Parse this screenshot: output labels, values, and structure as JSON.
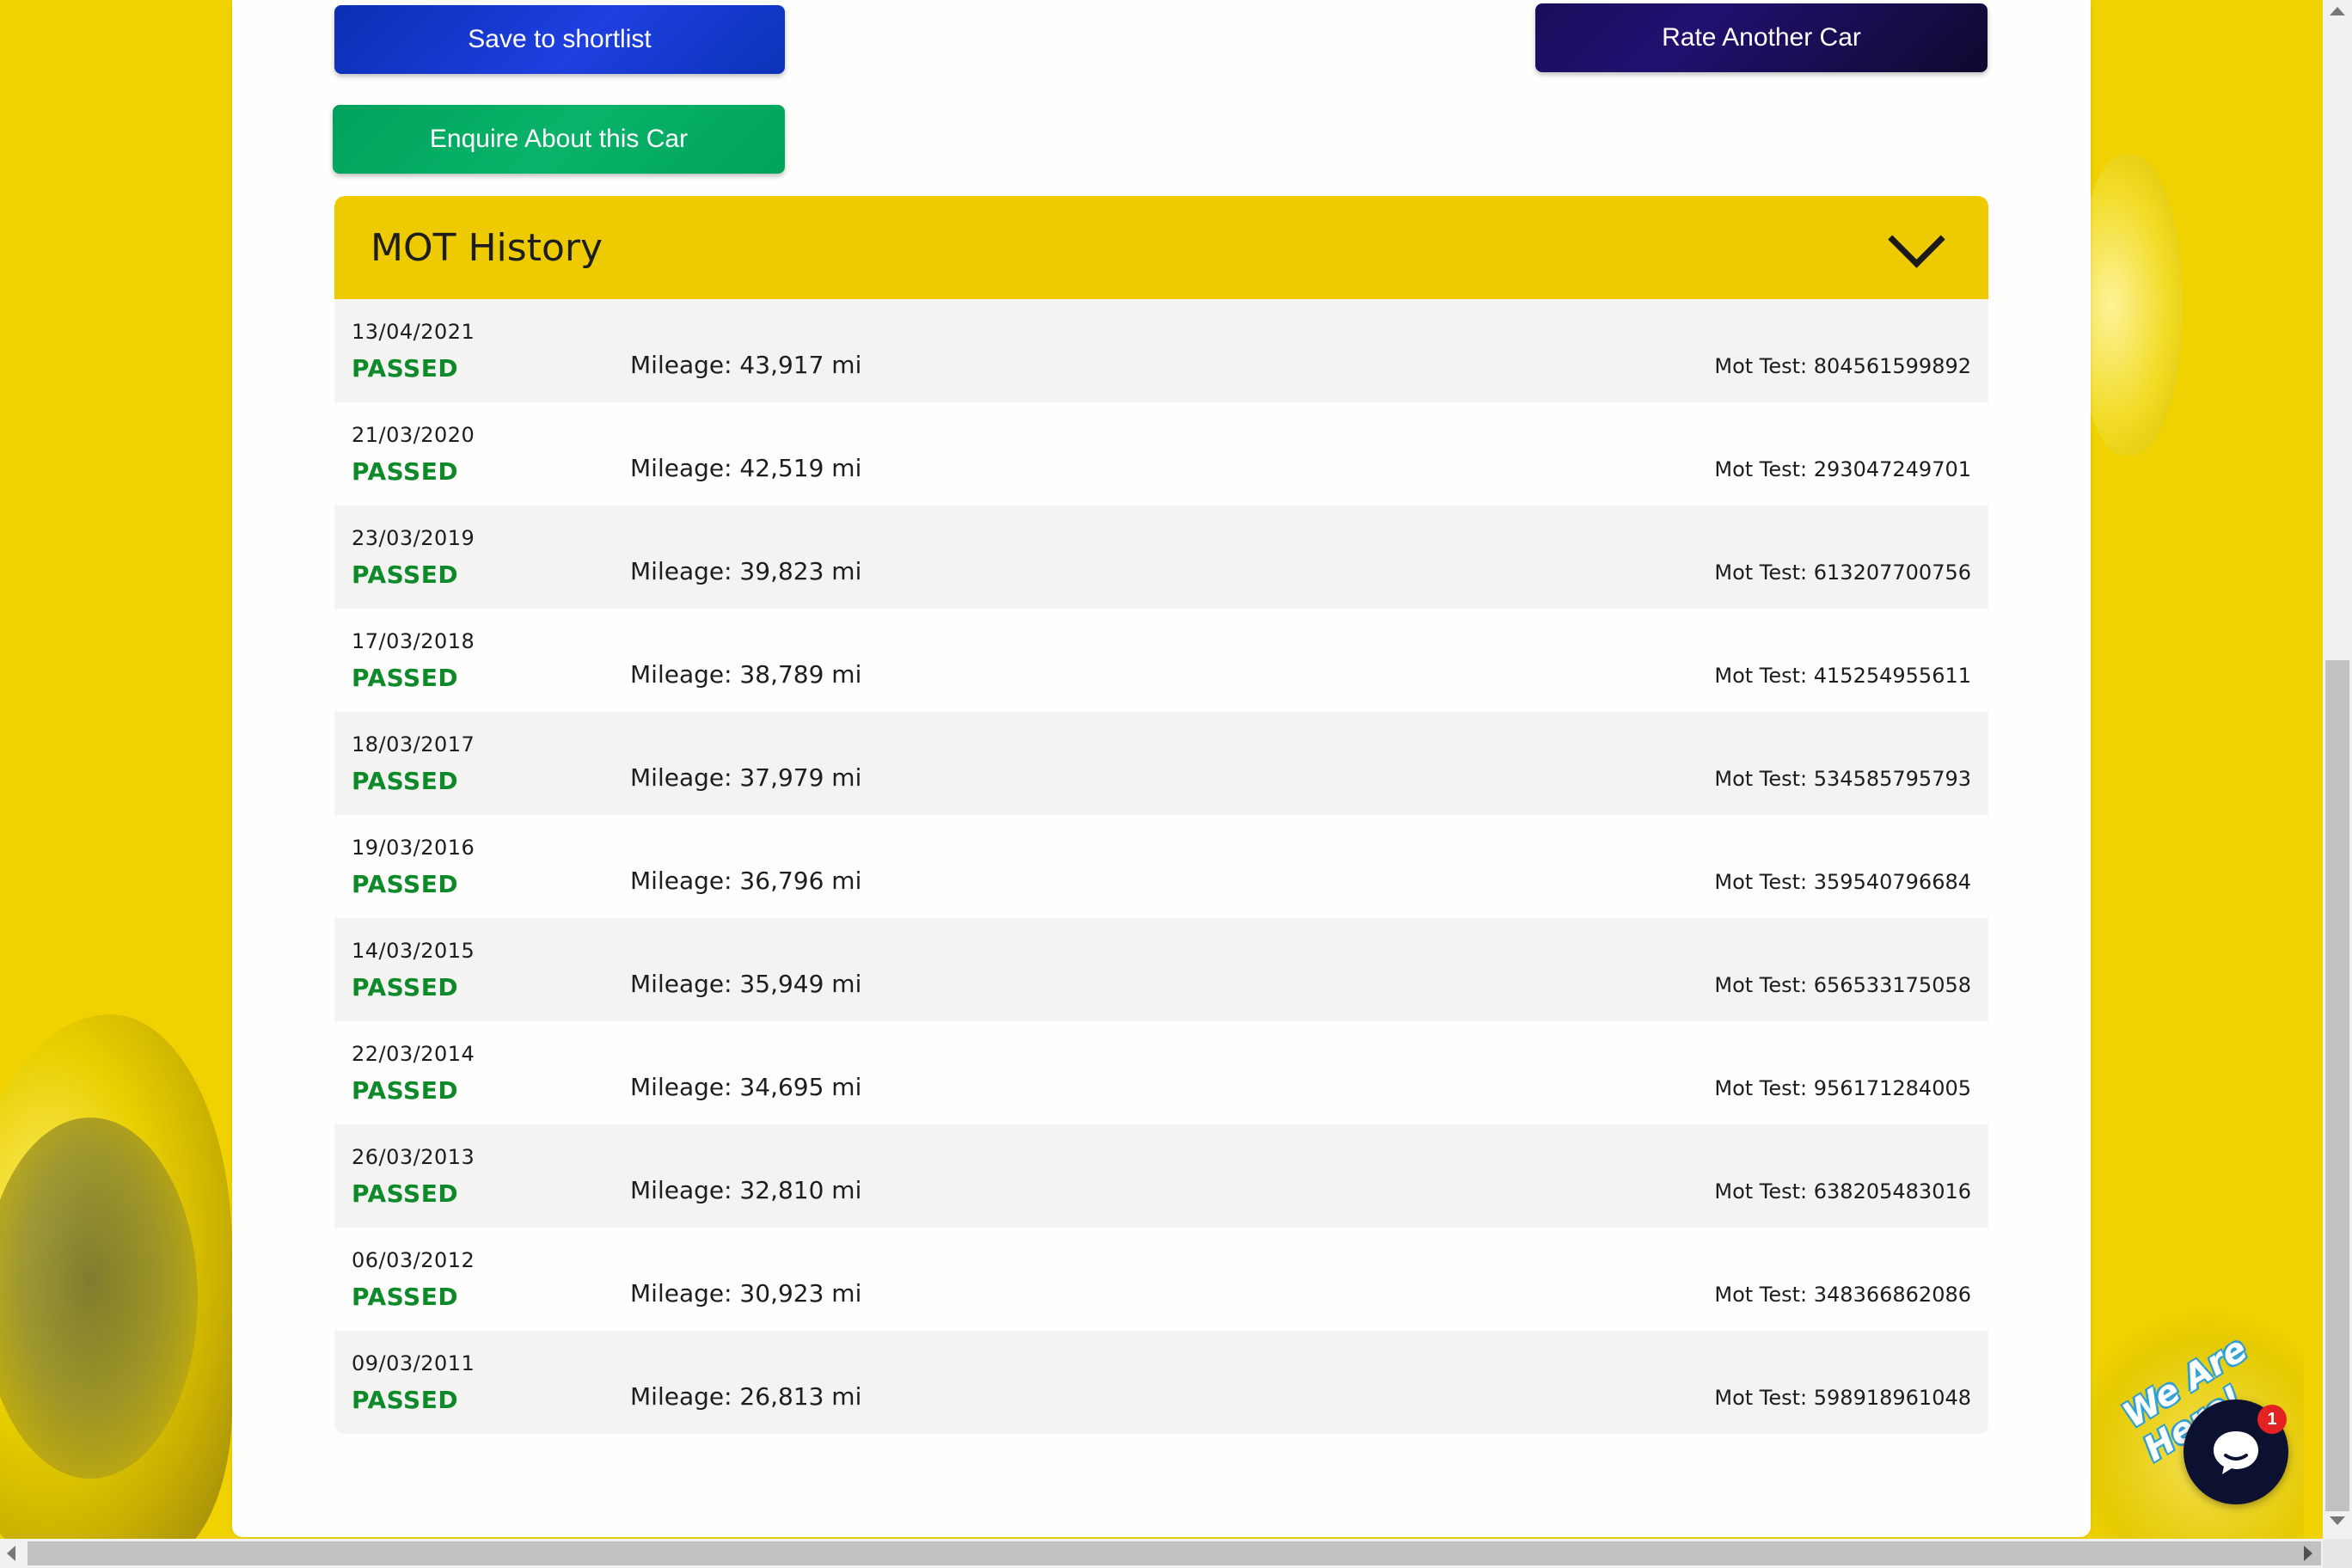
{
  "buttons": {
    "save": "Save to shortlist",
    "rate": "Rate Another Car",
    "enquire": "Enquire About this Car"
  },
  "mot": {
    "title": "MOT History",
    "rows": [
      {
        "date": "13/04/2021",
        "status": "PASSED",
        "mileage": "Mileage: 43,917 mi",
        "test": "Mot Test: 804561599892"
      },
      {
        "date": "21/03/2020",
        "status": "PASSED",
        "mileage": "Mileage: 42,519 mi",
        "test": "Mot Test: 293047249701"
      },
      {
        "date": "23/03/2019",
        "status": "PASSED",
        "mileage": "Mileage: 39,823 mi",
        "test": "Mot Test: 613207700756"
      },
      {
        "date": "17/03/2018",
        "status": "PASSED",
        "mileage": "Mileage: 38,789 mi",
        "test": "Mot Test: 415254955611"
      },
      {
        "date": "18/03/2017",
        "status": "PASSED",
        "mileage": "Mileage: 37,979 mi",
        "test": "Mot Test: 534585795793"
      },
      {
        "date": "19/03/2016",
        "status": "PASSED",
        "mileage": "Mileage: 36,796 mi",
        "test": "Mot Test: 359540796684"
      },
      {
        "date": "14/03/2015",
        "status": "PASSED",
        "mileage": "Mileage: 35,949 mi",
        "test": "Mot Test: 656533175058"
      },
      {
        "date": "22/03/2014",
        "status": "PASSED",
        "mileage": "Mileage: 34,695 mi",
        "test": "Mot Test: 956171284005"
      },
      {
        "date": "26/03/2013",
        "status": "PASSED",
        "mileage": "Mileage: 32,810 mi",
        "test": "Mot Test: 638205483016"
      },
      {
        "date": "06/03/2012",
        "status": "PASSED",
        "mileage": "Mileage: 30,923 mi",
        "test": "Mot Test: 348366862086"
      },
      {
        "date": "09/03/2011",
        "status": "PASSED",
        "mileage": "Mileage: 26,813 mi",
        "test": "Mot Test: 598918961048"
      }
    ]
  },
  "chat": {
    "label": "We Are Here!",
    "badge": "1"
  },
  "icons": {
    "collapse": "chevron-down-icon",
    "chat": "chat-bubble-icon"
  },
  "colors": {
    "background": "#f0d200",
    "header": "#edcb00",
    "passed": "#0f8a2a",
    "save_button": "#0a2fb3",
    "rate_button": "#1a0d5c",
    "enquire_button": "#00a25c",
    "chat_button": "#0c1130",
    "badge": "#e32222"
  }
}
